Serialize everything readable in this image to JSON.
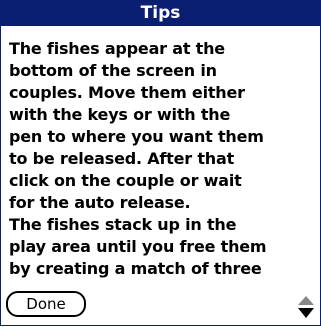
{
  "dialog": {
    "title": "Tips",
    "lines": [
      "The fishes appear at the",
      "bottom of the screen in",
      "couples. Move them either",
      "with the keys or with the",
      "pen to where you want them",
      "to be released. After that",
      "click on the couple or wait",
      "for the auto release.",
      "The fishes stack up in the",
      "play area until you free them",
      "by creating a match of three"
    ],
    "done_label": "Done"
  },
  "icons": {
    "scroll": "scroll-up-down-arrows-icon"
  },
  "colors": {
    "titlebar": "#0b1f72",
    "text": "#000000",
    "background": "#ffffff"
  }
}
